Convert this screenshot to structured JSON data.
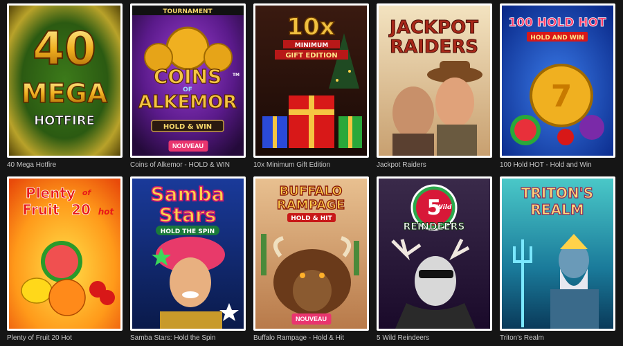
{
  "games": [
    {
      "caption": "40 Mega Hotfire",
      "art": {
        "line1": "40",
        "line2": "MEGA",
        "line3": "HOTFIRE"
      }
    },
    {
      "caption": "Coins of Alkemor - HOLD & WIN",
      "art": {
        "top": "TOURNAMENT",
        "line1": "COINS",
        "line2": "OF",
        "line3": "ALKEMOR",
        "sub": "HOLD & WIN",
        "tm": "TM"
      },
      "badge": "NOUVEAU"
    },
    {
      "caption": "10x Minimum Gift Edition",
      "art": {
        "line1": "10x",
        "line2": "MINIMUM",
        "line3": "GIFT EDITION"
      }
    },
    {
      "caption": "Jackpot Raiders",
      "art": {
        "line1": "JACKPOT",
        "line2": "RAIDERS"
      }
    },
    {
      "caption": "100 Hold HOT - Hold and Win",
      "art": {
        "line1": "100 HOLD HOT",
        "sub": "HOLD AND WIN"
      }
    },
    {
      "caption": "Plenty of Fruit 20 Hot",
      "art": {
        "line1": "Plenty",
        "of": "of",
        "line2": "Fruit",
        "num": "20",
        "hot": "hot"
      }
    },
    {
      "caption": "Samba Stars: Hold the Spin",
      "art": {
        "line1": "Samba",
        "line2": "Stars",
        "sub": "HOLD THE SPIN"
      }
    },
    {
      "caption": "Buffalo Rampage - Hold & Hit",
      "art": {
        "line1": "BUFFALO",
        "line2": "RAMPAGE",
        "sub": "HOLD & HIT"
      },
      "badge": "NOUVEAU"
    },
    {
      "caption": "5 Wild Reindeers",
      "art": {
        "num": "5",
        "wild": "Wild",
        "line1": "REINDEERS"
      }
    },
    {
      "caption": "Triton's Realm",
      "art": {
        "line1": "TRITON'S",
        "line2": "REALM"
      }
    }
  ],
  "colors": {
    "background": "#151515",
    "badge": "#e9356f",
    "caption": "#c9c9c9",
    "frame": "#ffffff"
  }
}
